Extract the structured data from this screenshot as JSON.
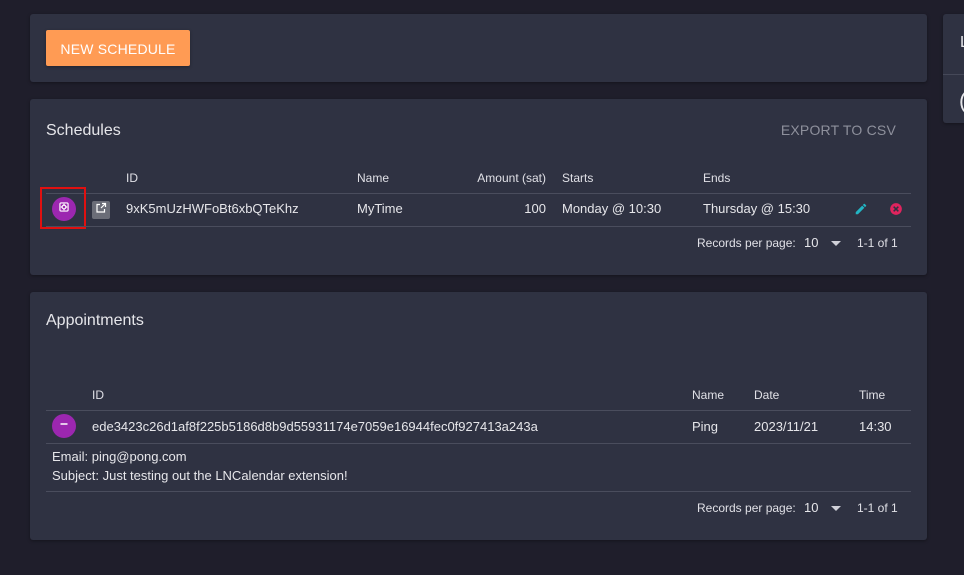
{
  "top": {
    "new_schedule_label": "NEW SCHEDULE"
  },
  "side": {
    "line1": "L",
    "line2": "("
  },
  "schedules": {
    "title": "Schedules",
    "export_label": "EXPORT TO CSV",
    "columns": {
      "id": "ID",
      "name": "Name",
      "amount": "Amount (sat)",
      "starts": "Starts",
      "ends": "Ends"
    },
    "rows": [
      {
        "id": "9xK5mUzHWFoBt6xbQTeKhz",
        "name": "MyTime",
        "amount": "100",
        "starts": "Monday @ 10:30",
        "ends": "Thursday @ 15:30"
      }
    ],
    "pagination": {
      "label": "Records per page:",
      "per_page": "10",
      "range": "1-1 of 1"
    }
  },
  "appointments": {
    "title": "Appointments",
    "columns": {
      "id": "ID",
      "name": "Name",
      "date": "Date",
      "time": "Time"
    },
    "rows": [
      {
        "id": "ede3423c26d1af8f225b5186d8b9d55931174e7059e16944fec0f927413a243a",
        "name": "Ping",
        "date": "2023/11/21",
        "time": "14:30"
      }
    ],
    "details": {
      "email": "Email: ping@pong.com",
      "subject": "Subject: Just testing out the LNCalendar extension!"
    },
    "pagination": {
      "label": "Records per page:",
      "per_page": "10",
      "range": "1-1 of 1"
    }
  },
  "colors": {
    "accent": "#ff9b54",
    "purple": "#9c27b0",
    "edit": "#22b5c4",
    "delete": "#e0245e",
    "highlight": "#e01010"
  },
  "icons": {
    "expand": "gear-icon",
    "open": "open-in-new-icon",
    "edit": "pencil-icon",
    "delete": "cancel-icon",
    "collapse": "minus-icon"
  }
}
